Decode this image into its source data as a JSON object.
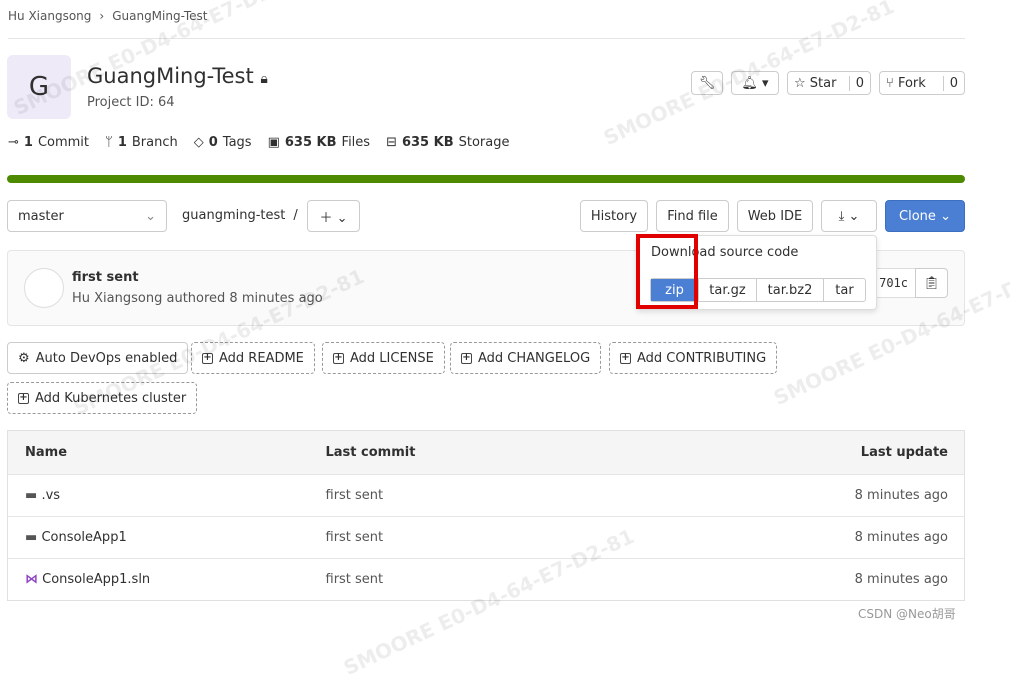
{
  "breadcrumb": [
    "Hu Xiangsong",
    "GuangMing-Test"
  ],
  "project": {
    "avatar_letter": "G",
    "name": "GuangMing-Test",
    "id_label": "Project ID: 64"
  },
  "actions": {
    "star": "Star",
    "star_count": "0",
    "fork": "Fork",
    "fork_count": "0"
  },
  "stats": [
    {
      "num": "1",
      "label": "Commit",
      "icon": "commit-icon"
    },
    {
      "num": "1",
      "label": "Branch",
      "icon": "branch-icon"
    },
    {
      "num": "0",
      "label": "Tags",
      "icon": "tag-icon"
    },
    {
      "num": "635 KB",
      "label": "Files",
      "icon": "file-icon"
    },
    {
      "num": "635 KB",
      "label": "Storage",
      "icon": "storage-icon"
    }
  ],
  "progress_color": "#4e8a00",
  "toolbar": {
    "branch": "master",
    "path": "guangming-test",
    "sep": "/",
    "history": "History",
    "find_file": "Find file",
    "web_ide": "Web IDE",
    "clone": "Clone"
  },
  "download": {
    "title": "Download source code",
    "formats": [
      "zip",
      "tar.gz",
      "tar.bz2",
      "tar"
    ]
  },
  "commit": {
    "message": "first sent",
    "author": "Hu Xiangsong",
    "meta": "authored 8 minutes ago",
    "sha": "701c"
  },
  "shortcuts": [
    "Auto DevOps enabled",
    "Add README",
    "Add LICENSE",
    "Add CHANGELOG",
    "Add CONTRIBUTING",
    "Add Kubernetes cluster"
  ],
  "table": {
    "headers": [
      "Name",
      "Last commit",
      "Last update"
    ],
    "rows": [
      {
        "name": ".vs",
        "commit": "first sent",
        "update": "8 minutes ago",
        "icon": "folder-icon"
      },
      {
        "name": "ConsoleApp1",
        "commit": "first sent",
        "update": "8 minutes ago",
        "icon": "folder-icon"
      },
      {
        "name": "ConsoleApp1.sln",
        "commit": "first sent",
        "update": "8 minutes ago",
        "icon": "visual-studio-icon"
      }
    ]
  },
  "watermark": "SMOORE E0-D4-64-E7-D2-81",
  "footer": "CSDN @Neo胡哥",
  "colors": {
    "primary": "#1f75cb",
    "clone": "#4a7fd4",
    "highlight": "#e00000"
  }
}
